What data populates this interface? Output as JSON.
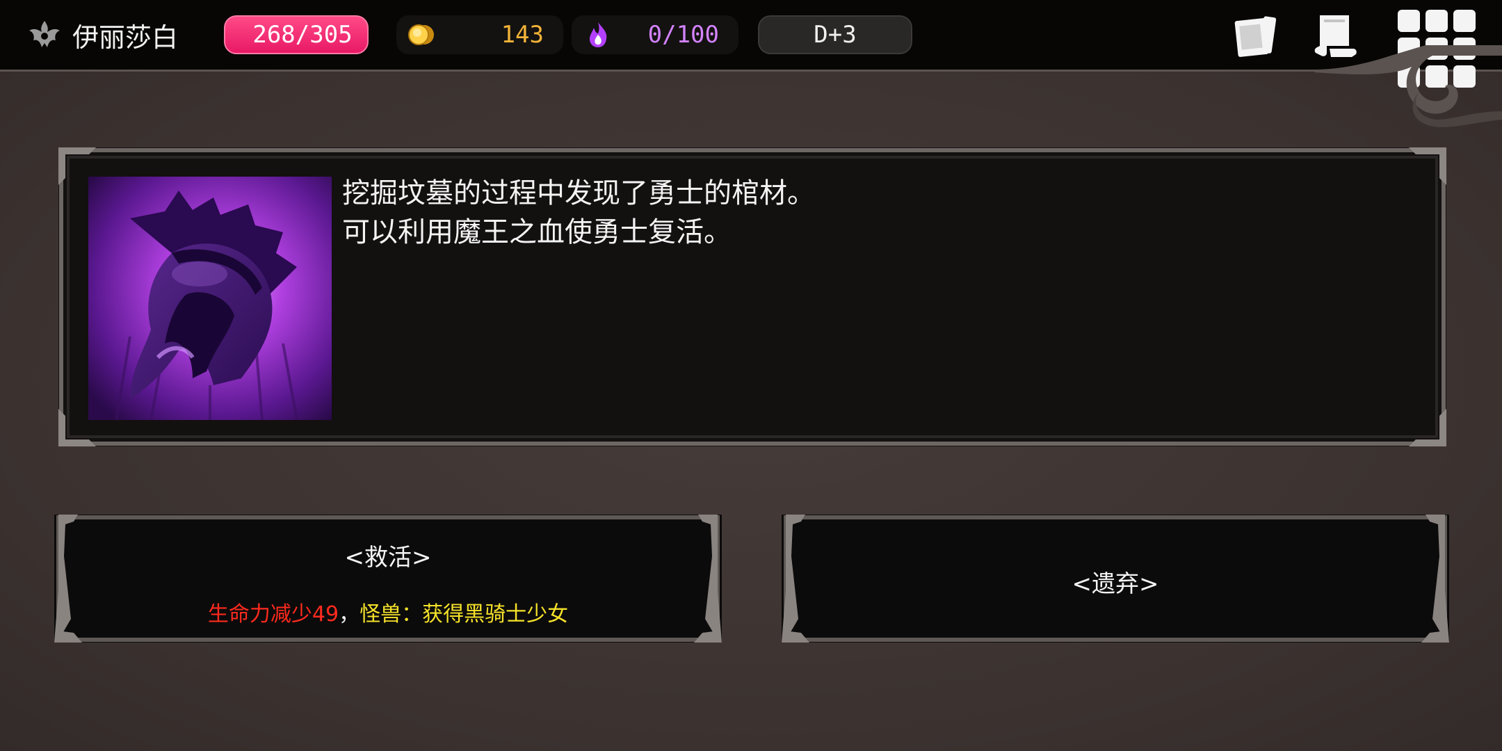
{
  "hud": {
    "player_name": "伊丽莎白",
    "player_icon": "demon-crest-icon",
    "hp": "268/305",
    "hp_color": "#e81966",
    "gold": "143",
    "gold_color": "#f2b338",
    "soul": "0/100",
    "soul_color": "#d483ff",
    "day": "D+3",
    "buttons": [
      "cards-icon",
      "scroll-icon",
      "grid-menu-icon"
    ]
  },
  "event": {
    "image_icon": "spartan-helmet-icon",
    "lines": [
      "挖掘坟墓的过程中发现了勇士的棺材。",
      "可以利用魔王之血使勇士复活。"
    ]
  },
  "choices": {
    "revive": {
      "label": "<救活>",
      "effect_cost": "生命力减少49",
      "effect_sep": "，",
      "effect_reward": "怪兽：获得黑骑士少女"
    },
    "abandon": {
      "label": "<遗弃>"
    }
  }
}
